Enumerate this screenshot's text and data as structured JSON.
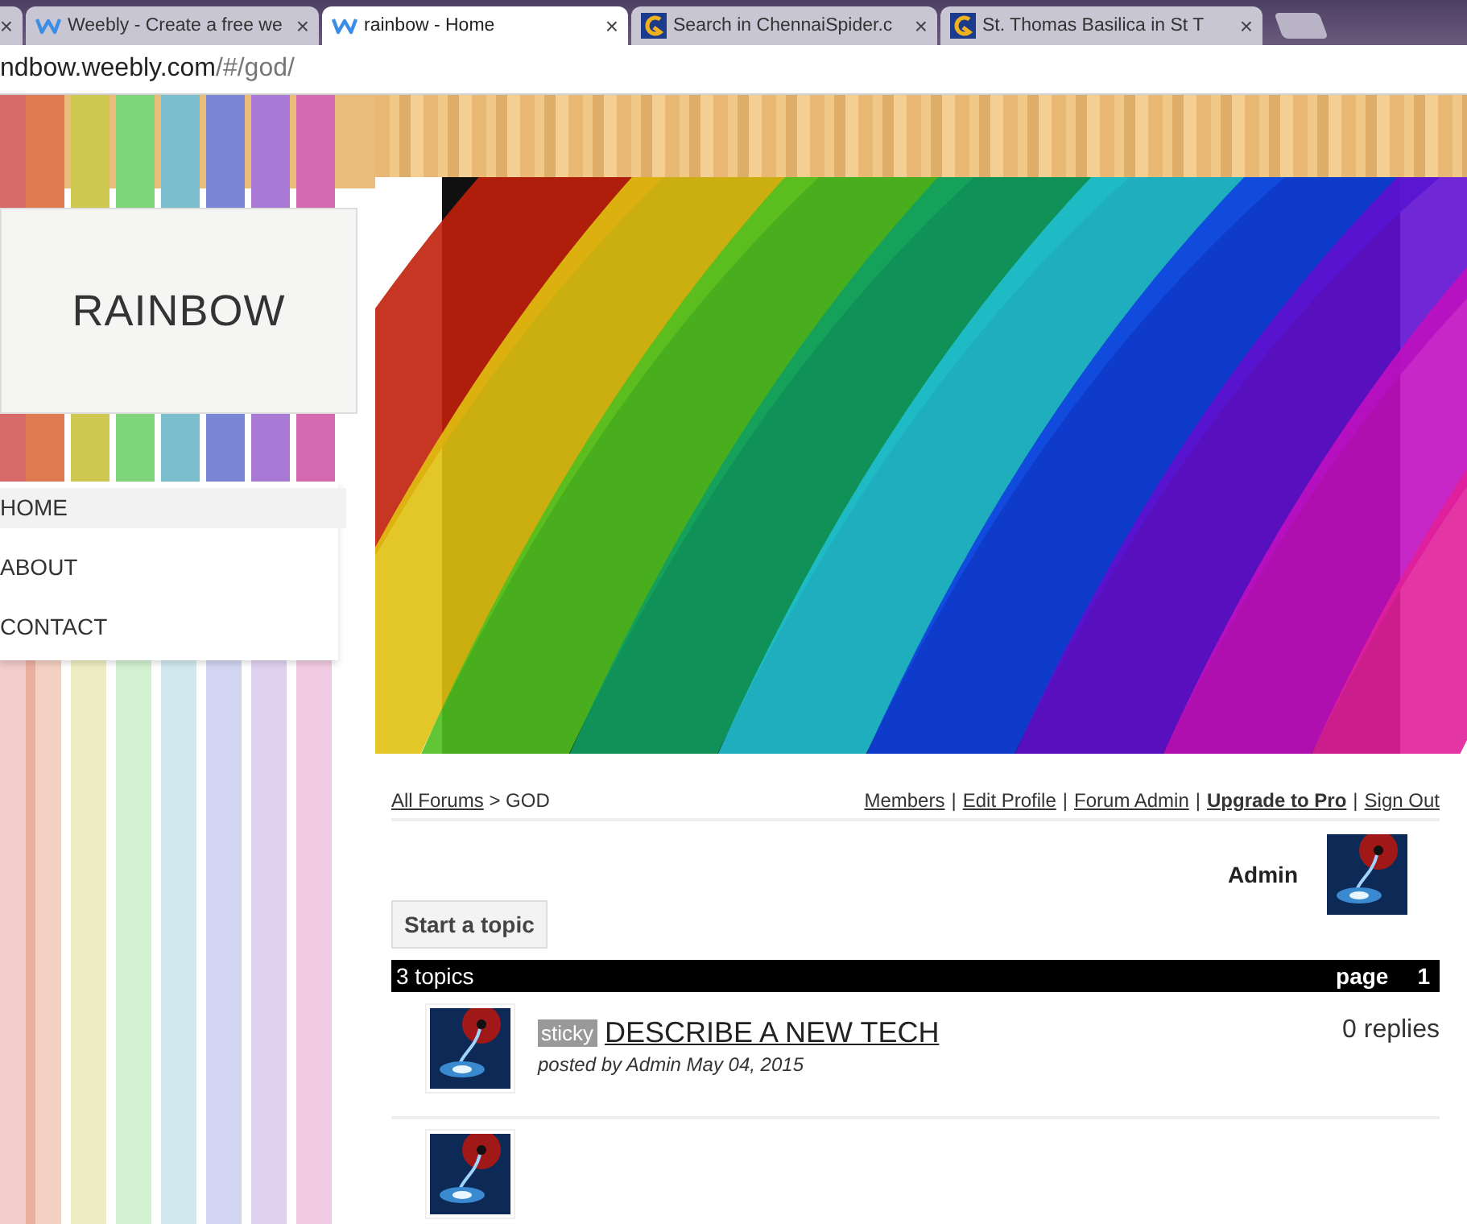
{
  "browser": {
    "tabs": [
      {
        "selected": false
      },
      {
        "label": "Weebly - Create a free we",
        "selected": false
      },
      {
        "label": "rainbow - Home",
        "selected": true
      },
      {
        "label": "Search in ChennaiSpider.c",
        "selected": false
      },
      {
        "label": "St. Thomas Basilica in St T",
        "selected": false
      }
    ],
    "close_glyph": "×",
    "address": {
      "host": "ndbow.weebly.com",
      "path": "/#/god/"
    }
  },
  "site": {
    "title": "RAINBOW",
    "nav": [
      {
        "label": "HOME",
        "selected": true
      },
      {
        "label": "ABOUT",
        "selected": false
      },
      {
        "label": "CONTACT",
        "selected": false
      }
    ]
  },
  "forum": {
    "breadcrumb": {
      "link": "All Forums",
      "rest": "> GOD"
    },
    "links": [
      {
        "label": "Members",
        "bold": false
      },
      {
        "label": "Edit Profile",
        "bold": false
      },
      {
        "label": "Forum Admin",
        "bold": false
      },
      {
        "label": "Upgrade to Pro",
        "bold": true
      },
      {
        "label": "Sign Out",
        "bold": false
      }
    ],
    "separator": "|",
    "user": "Admin",
    "start_button": "Start a topic",
    "bar": {
      "count": "3 topics",
      "page_label": "page",
      "page": "1"
    },
    "topics": [
      {
        "badge": "sticky",
        "title": "DESCRIBE A NEW TECH",
        "byline": "posted by Admin May 04, 2015",
        "replies": "0 replies"
      }
    ]
  }
}
